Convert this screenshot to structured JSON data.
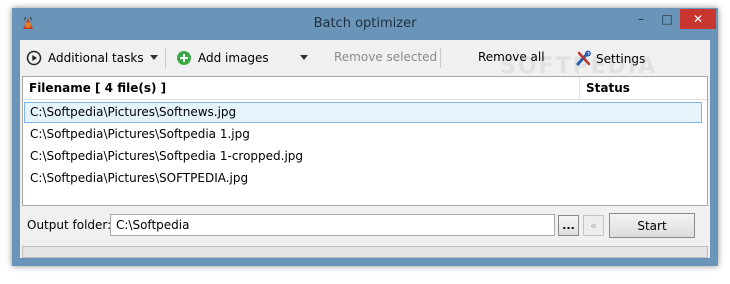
{
  "window": {
    "title": "Batch optimizer",
    "controls": {
      "minimize": "–",
      "maximize": "□",
      "close": "✕"
    },
    "close_color": "#c7372f"
  },
  "toolbar": {
    "additional_tasks": "Additional tasks",
    "add_images": "Add images",
    "remove_selected": "Remove selected",
    "remove_all": "Remove all",
    "settings": "Settings"
  },
  "list": {
    "columns": {
      "filename": "Filename [ 4 file(s) ]",
      "status": "Status"
    },
    "rows": [
      {
        "filename": "C:\\Softpedia\\Pictures\\Softnews.jpg",
        "selected": true
      },
      {
        "filename": "C:\\Softpedia\\Pictures\\Softpedia 1.jpg",
        "selected": false
      },
      {
        "filename": "C:\\Softpedia\\Pictures\\Softpedia 1-cropped.jpg",
        "selected": false
      },
      {
        "filename": "C:\\Softpedia\\Pictures\\SOFTPEDIA.jpg",
        "selected": false
      }
    ]
  },
  "watermark": {
    "text": "SOFTPEDIA",
    "url": "www.softpedia.com"
  },
  "output": {
    "label": "Output folder:",
    "value": "C:\\Softpedia",
    "browse_label": "...",
    "back_label": "«",
    "start_label": "Start"
  },
  "icons": {
    "app": "app-icon",
    "additional_tasks": "play-circle-icon",
    "add_images": "plus-circle-icon",
    "settings": "tools-icon"
  }
}
